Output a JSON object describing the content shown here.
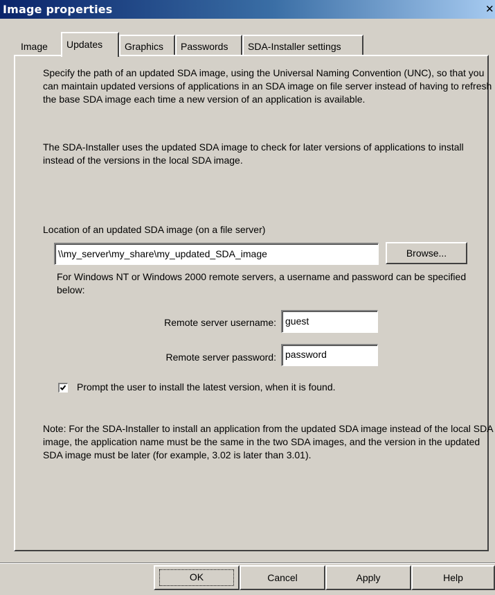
{
  "window": {
    "title": "Image properties",
    "close_glyph": "✕"
  },
  "tabs": [
    {
      "label": "Image",
      "active": false
    },
    {
      "label": "Updates",
      "active": true
    },
    {
      "label": "Graphics",
      "active": false
    },
    {
      "label": "Passwords",
      "active": false
    },
    {
      "label": "SDA-Installer settings",
      "active": false
    }
  ],
  "intro": {
    "p1": "Specify the path of an updated SDA image, using the Universal Naming Convention (UNC), so that you can maintain updated versions of applications in an SDA image on file server instead of having to refresh the base SDA image each time a new version of an application is available.",
    "p2": "The SDA-Installer uses the updated SDA image to check for later versions of applications to install instead of the versions in the local SDA image."
  },
  "location": {
    "label": "Location of an updated SDA image (on a file server)",
    "value": "\\\\my_server\\my_share\\my_updated_SDA_image",
    "browse_label": "Browse..."
  },
  "remote": {
    "info": "For Windows NT or Windows 2000 remote servers, a username and password can be specified below:",
    "username_label": "Remote server username:",
    "username_value": "guest",
    "password_label": "Remote server password:",
    "password_value": "password"
  },
  "prompt": {
    "checked": true,
    "label": "Prompt the user to install the latest version, when it is found."
  },
  "note": "Note:  For the SDA-Installer to install an application from the updated SDA image instead of the local SDA image, the application name must be the same in the two SDA images, and the version in the updated SDA image must be later (for example, 3.02 is later than 3.01).",
  "buttons": {
    "ok": "OK",
    "cancel": "Cancel",
    "apply": "Apply",
    "help": "Help"
  }
}
